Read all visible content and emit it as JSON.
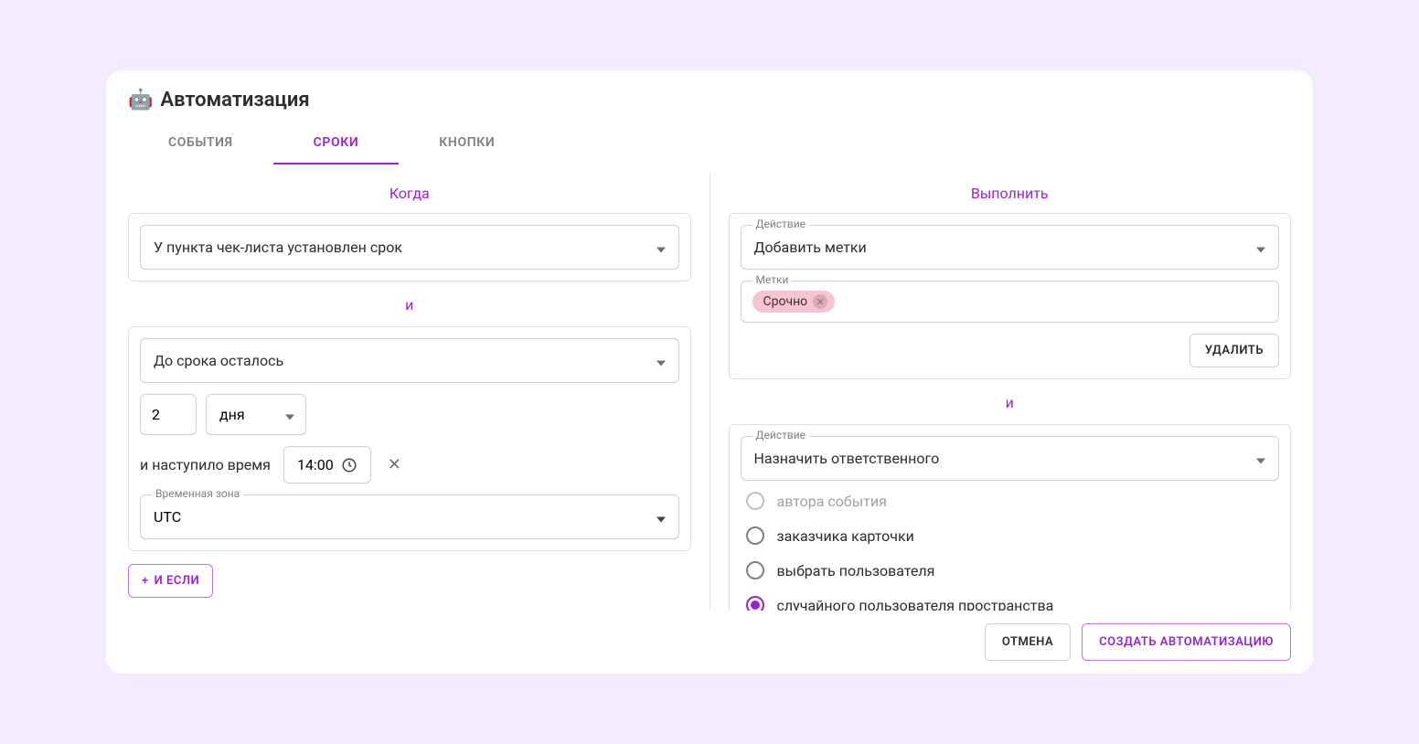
{
  "header": {
    "icon": "🤖",
    "title": "Автоматизация"
  },
  "tabs": [
    {
      "label": "СОБЫТИЯ",
      "active": false
    },
    {
      "label": "СРОКИ",
      "active": true
    },
    {
      "label": "КНОПКИ",
      "active": false
    }
  ],
  "left": {
    "section_title": "Когда",
    "trigger": {
      "selected": "У пункта чек-листа установлен срок"
    },
    "conj": "и",
    "condition": {
      "relative": "До срока осталось",
      "amount": "2",
      "unit": "дня",
      "time_label": "и наступило время",
      "time_value": "14:00",
      "tz_label": "Временная зона",
      "tz_value": "UTC"
    },
    "add_condition": "И ЕСЛИ"
  },
  "right": {
    "section_title": "Выполнить",
    "action1": {
      "label": "Действие",
      "value": "Добавить метки",
      "chips_label": "Метки",
      "chips": [
        "Срочно"
      ],
      "delete": "УДАЛИТЬ"
    },
    "conj": "и",
    "action2": {
      "label": "Действие",
      "value": "Назначить ответственного",
      "options": [
        {
          "label": "автора события",
          "state": "disabled"
        },
        {
          "label": "заказчика карточки",
          "state": "normal"
        },
        {
          "label": "выбрать пользователя",
          "state": "normal"
        },
        {
          "label": "случайного пользователя пространства",
          "state": "selected"
        }
      ]
    }
  },
  "footer": {
    "cancel": "ОТМЕНА",
    "create": "СОЗДАТЬ АВТОМАТИЗАЦИЮ"
  }
}
